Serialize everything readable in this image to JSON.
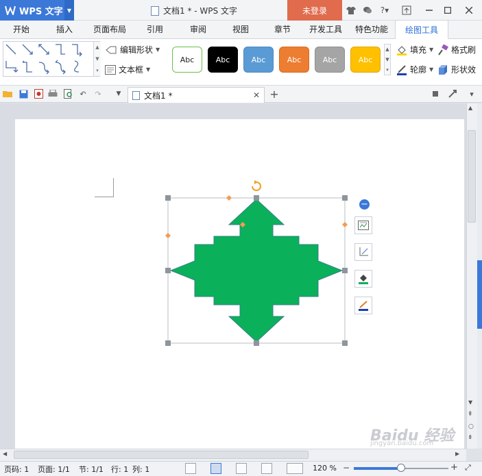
{
  "app": {
    "name": "WPS 文字",
    "logo_letter": "W",
    "login_label": "未登录",
    "window_title": "文档1 * - WPS 文字"
  },
  "tabs": [
    {
      "label": "开始"
    },
    {
      "label": "插入"
    },
    {
      "label": "页面布局"
    },
    {
      "label": "引用"
    },
    {
      "label": "审阅"
    },
    {
      "label": "视图"
    },
    {
      "label": "章节"
    },
    {
      "label": "开发工具"
    },
    {
      "label": "特色功能"
    },
    {
      "label": "绘图工具",
      "active": true
    }
  ],
  "ribbon": {
    "edit_shape_label": "编辑形状",
    "text_box_label": "文本框",
    "styles": [
      {
        "label": "Abc",
        "bg": "#ffffff",
        "fg": "#222222",
        "border": "#6cbf4a"
      },
      {
        "label": "Abc",
        "bg": "#000000",
        "fg": "#ffffff",
        "border": "#000000"
      },
      {
        "label": "Abc",
        "bg": "#5b9bd5",
        "fg": "#ffffff",
        "border": "#4a88c2"
      },
      {
        "label": "Abc",
        "bg": "#ed7d31",
        "fg": "#ffffff",
        "border": "#d66a22"
      },
      {
        "label": "Abc",
        "bg": "#a5a5a5",
        "fg": "#ffffff",
        "border": "#8f8f8f"
      },
      {
        "label": "Abc",
        "bg": "#ffc000",
        "fg": "#ffffff",
        "border": "#e0a800"
      }
    ],
    "fill_label": "填充",
    "format_painter_label": "格式刷",
    "outline_label": "轮廓",
    "shape_effect_label": "形状效"
  },
  "quickbar": {
    "doc_tab_label": "文档1 *"
  },
  "document": {
    "shape_name": "four-way-arrow",
    "shape_color": "#0bb05a",
    "shape_stroke": "#3a7f8a"
  },
  "status": {
    "page_num": "页码: 1",
    "pages": "页面: 1/1",
    "section": "节: 1/1",
    "row": "行: 1",
    "col": "列: 1",
    "zoom": "120 %",
    "zoom_level": 0.5
  },
  "watermark": {
    "text": "Baidu 经验",
    "sub": "jingyan.baidu.com"
  }
}
